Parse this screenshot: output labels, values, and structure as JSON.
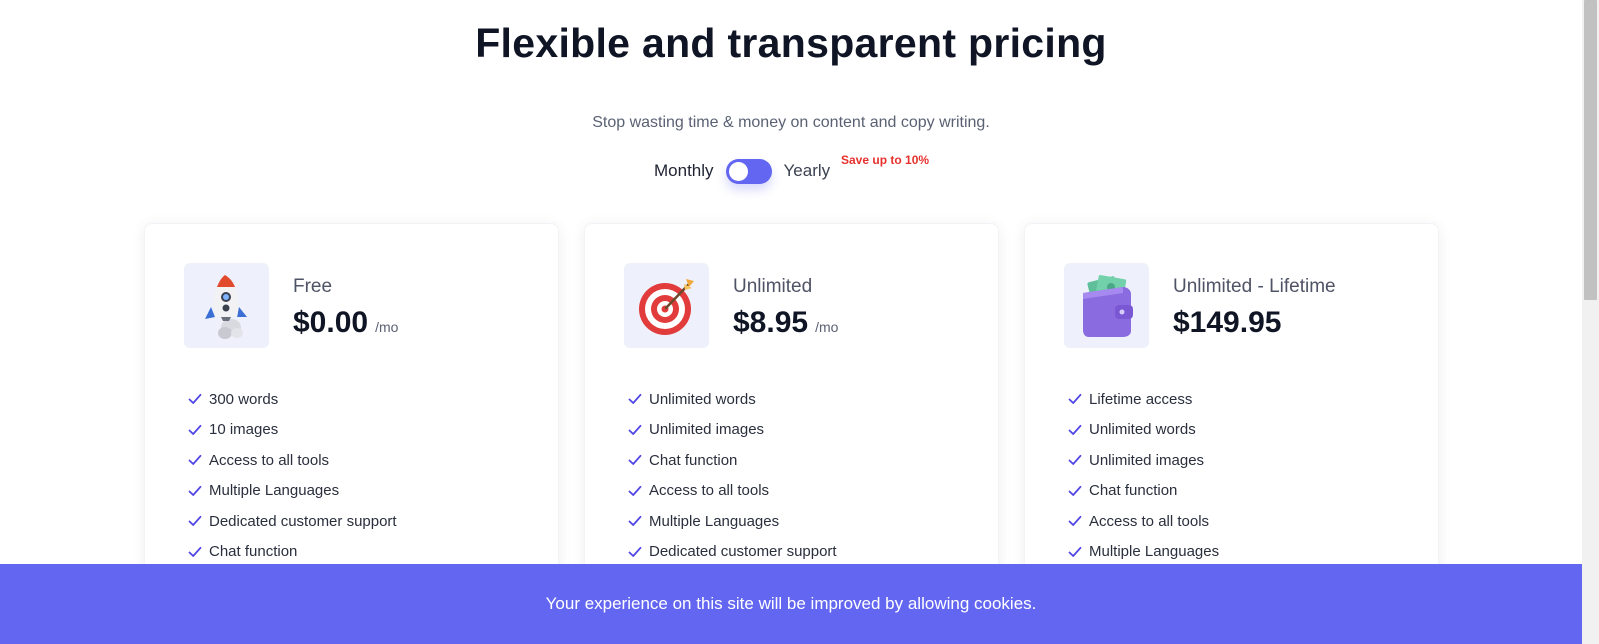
{
  "header": {
    "title": "Flexible and transparent pricing",
    "subtitle": "Stop wasting time & money on content and copy writing."
  },
  "billing": {
    "monthly_label": "Monthly",
    "yearly_label": "Yearly",
    "save_badge": "Save up to 10%",
    "selected": "Monthly"
  },
  "plans": [
    {
      "name": "Free",
      "price": "$0.00",
      "period": "/mo",
      "icon": "rocket-icon",
      "features": [
        "300 words",
        "10 images",
        "Access to all tools",
        "Multiple Languages",
        "Dedicated customer support",
        "Chat function"
      ]
    },
    {
      "name": "Unlimited",
      "price": "$8.95",
      "period": "/mo",
      "icon": "target-icon",
      "features": [
        "Unlimited words",
        "Unlimited images",
        "Chat function",
        "Access to all tools",
        "Multiple Languages",
        "Dedicated customer support"
      ]
    },
    {
      "name": "Unlimited - Lifetime",
      "price": "$149.95",
      "period": "",
      "icon": "wallet-icon",
      "features": [
        "Lifetime access",
        "Unlimited words",
        "Unlimited images",
        "Chat function",
        "Access to all tools",
        "Multiple Languages"
      ]
    }
  ],
  "cookie_banner": {
    "text": "Your experience on this site will be improved by allowing cookies."
  },
  "colors": {
    "accent": "#6366f1",
    "save_badge": "#e5322d",
    "check": "#4f46e5",
    "heading": "#0f1524"
  }
}
